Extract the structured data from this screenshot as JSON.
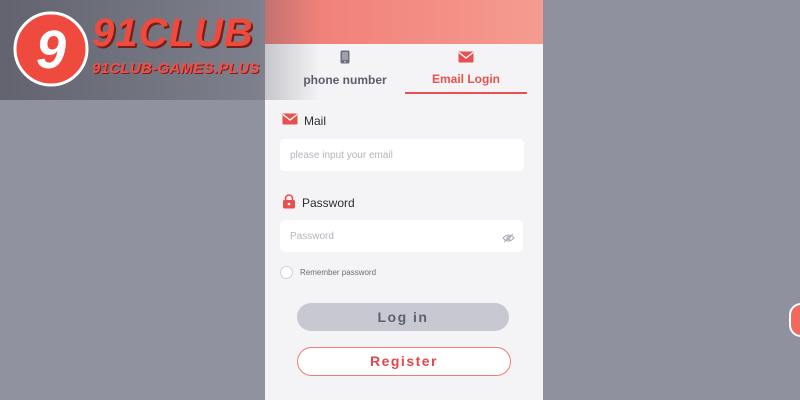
{
  "branding": {
    "logo_mark": "9",
    "title": "91CLUB",
    "subtitle": "91CLUB-GAMES.PLUS"
  },
  "tabs": [
    {
      "label": "phone number",
      "icon": "phone-icon",
      "active": false
    },
    {
      "label": "Email Login",
      "icon": "mail-icon",
      "active": true
    }
  ],
  "form": {
    "mail_label": "Mail",
    "email_placeholder": "please input your email",
    "email_value": "",
    "password_label": "Password",
    "password_placeholder": "Password",
    "password_value": "",
    "remember_label": "Remember password",
    "remember_checked": false
  },
  "buttons": {
    "login": "Log in",
    "register": "Register"
  },
  "colors": {
    "accent": "#e8504f",
    "header_gradient_start": "#f07b74",
    "header_gradient_end": "#f59b8f",
    "login_button_bg": "#c7c8d2",
    "page_background": "#8e919d",
    "panel_background": "#f4f4f6"
  }
}
